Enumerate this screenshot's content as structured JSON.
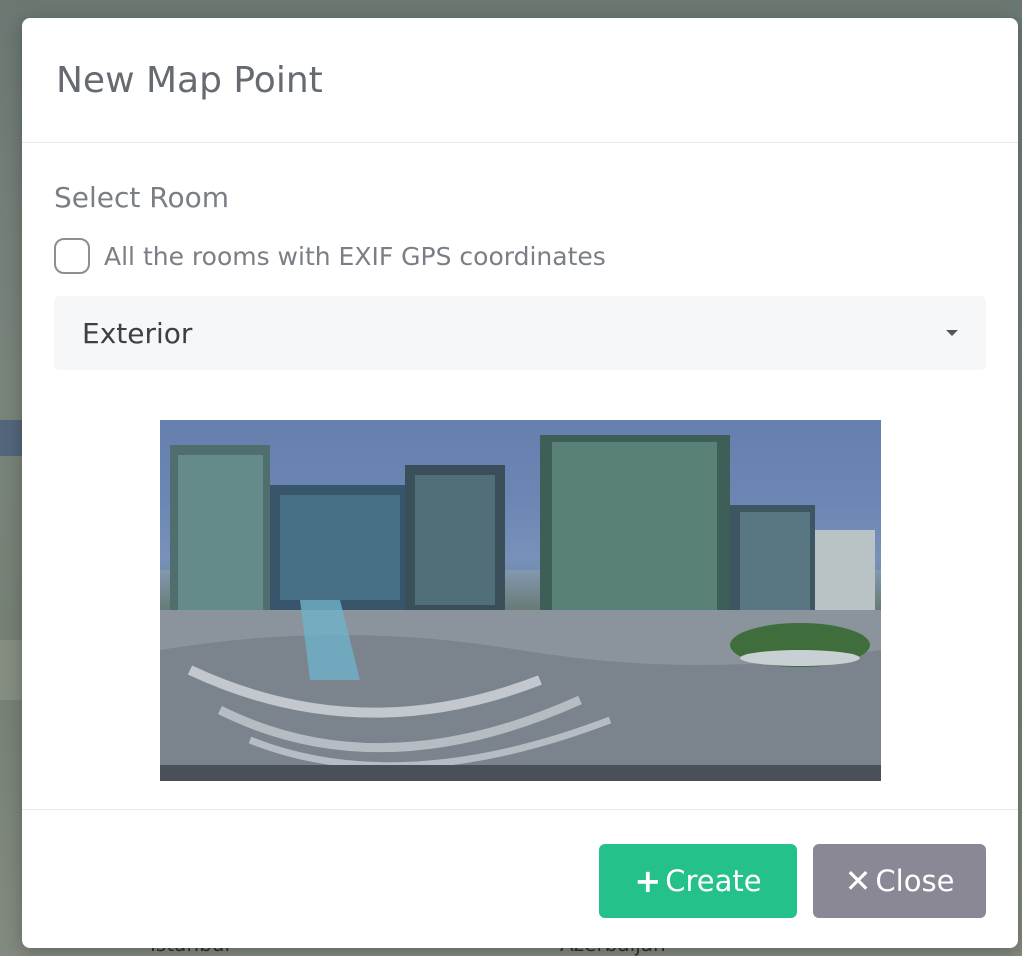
{
  "background_map": {
    "bottom_labels": [
      "Istanbul",
      "Azerbaijan"
    ]
  },
  "modal": {
    "title": "New Map Point",
    "section_label": "Select Room",
    "checkbox": {
      "label": "All the rooms with EXIF GPS coordinates",
      "checked": false
    },
    "room_select": {
      "selected": "Exterior"
    },
    "preview_image": {
      "alt": "Exterior 360 panorama"
    },
    "buttons": {
      "create": {
        "icon": "plus-icon",
        "label": "Create",
        "color": "#24c18a"
      },
      "close": {
        "icon": "close-icon",
        "label": "Close",
        "color": "#8a8894"
      }
    }
  }
}
